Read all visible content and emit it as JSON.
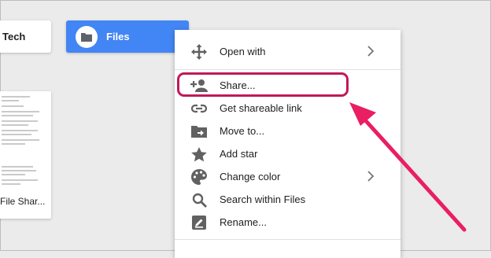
{
  "folders": {
    "tech_label": "Tech",
    "files_label": "Files"
  },
  "document": {
    "title": "File Shar..."
  },
  "context_menu": {
    "items": [
      {
        "label": "Open with",
        "icon": "open-with-icon",
        "has_submenu": true
      },
      {
        "label": "Share...",
        "icon": "person-add-icon",
        "has_submenu": false,
        "highlighted": true
      },
      {
        "label": "Get shareable link",
        "icon": "link-icon",
        "has_submenu": false
      },
      {
        "label": "Move to...",
        "icon": "move-to-folder-icon",
        "has_submenu": false
      },
      {
        "label": "Add star",
        "icon": "star-icon",
        "has_submenu": false
      },
      {
        "label": "Change color",
        "icon": "palette-icon",
        "has_submenu": true
      },
      {
        "label": "Search within Files",
        "icon": "search-icon",
        "has_submenu": false
      },
      {
        "label": "Rename...",
        "icon": "rename-icon",
        "has_submenu": false
      }
    ]
  },
  "colors": {
    "selected_folder": "#4285f4",
    "highlight": "#c2185b",
    "arrow": "#e91e63",
    "icon": "#616161"
  }
}
